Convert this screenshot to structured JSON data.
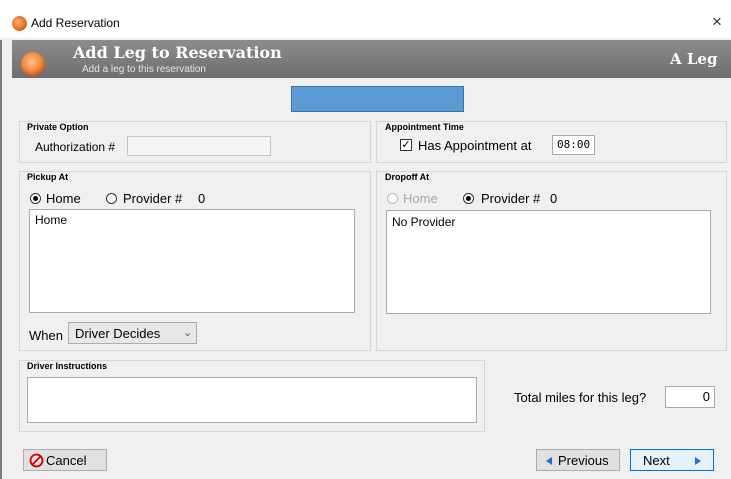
{
  "window": {
    "title": "Add Reservation",
    "close_glyph": "×"
  },
  "banner": {
    "title": "Add Leg to Reservation",
    "subtitle": "Add a leg to this reservation",
    "leg": "A Leg"
  },
  "private_option": {
    "title": "Private Option",
    "auth_label": "Authorization #",
    "auth_value": ""
  },
  "appointment": {
    "title": "Appointment Time",
    "checkbox_label": "Has Appointment at",
    "checked": true,
    "time": "08:00"
  },
  "pickup": {
    "title": "Pickup At",
    "home_label": "Home",
    "provider_label": "Provider #",
    "provider_num": "0",
    "selected": "home",
    "address": "Home",
    "when_label": "When",
    "when_value": "Driver Decides"
  },
  "dropoff": {
    "title": "Dropoff At",
    "home_label": "Home",
    "provider_label": "Provider #",
    "provider_num": "0",
    "selected": "provider",
    "address": "No Provider"
  },
  "driver": {
    "title": "Driver Instructions",
    "value": ""
  },
  "miles": {
    "label": "Total miles for this leg?",
    "value": "0"
  },
  "buttons": {
    "cancel": "Cancel",
    "previous": "Previous",
    "next": "Next"
  },
  "icons": {
    "cancel": "cancel-circle-icon",
    "previous": "triangle-left-icon",
    "next": "triangle-right-icon",
    "dropdown": "chevron-down-icon"
  },
  "colors": {
    "banner": "#7a7a7a",
    "blue_box": "#5b9bd5",
    "cancel_icon": "#d00000",
    "nav_arrow": "#1e6fd9"
  }
}
